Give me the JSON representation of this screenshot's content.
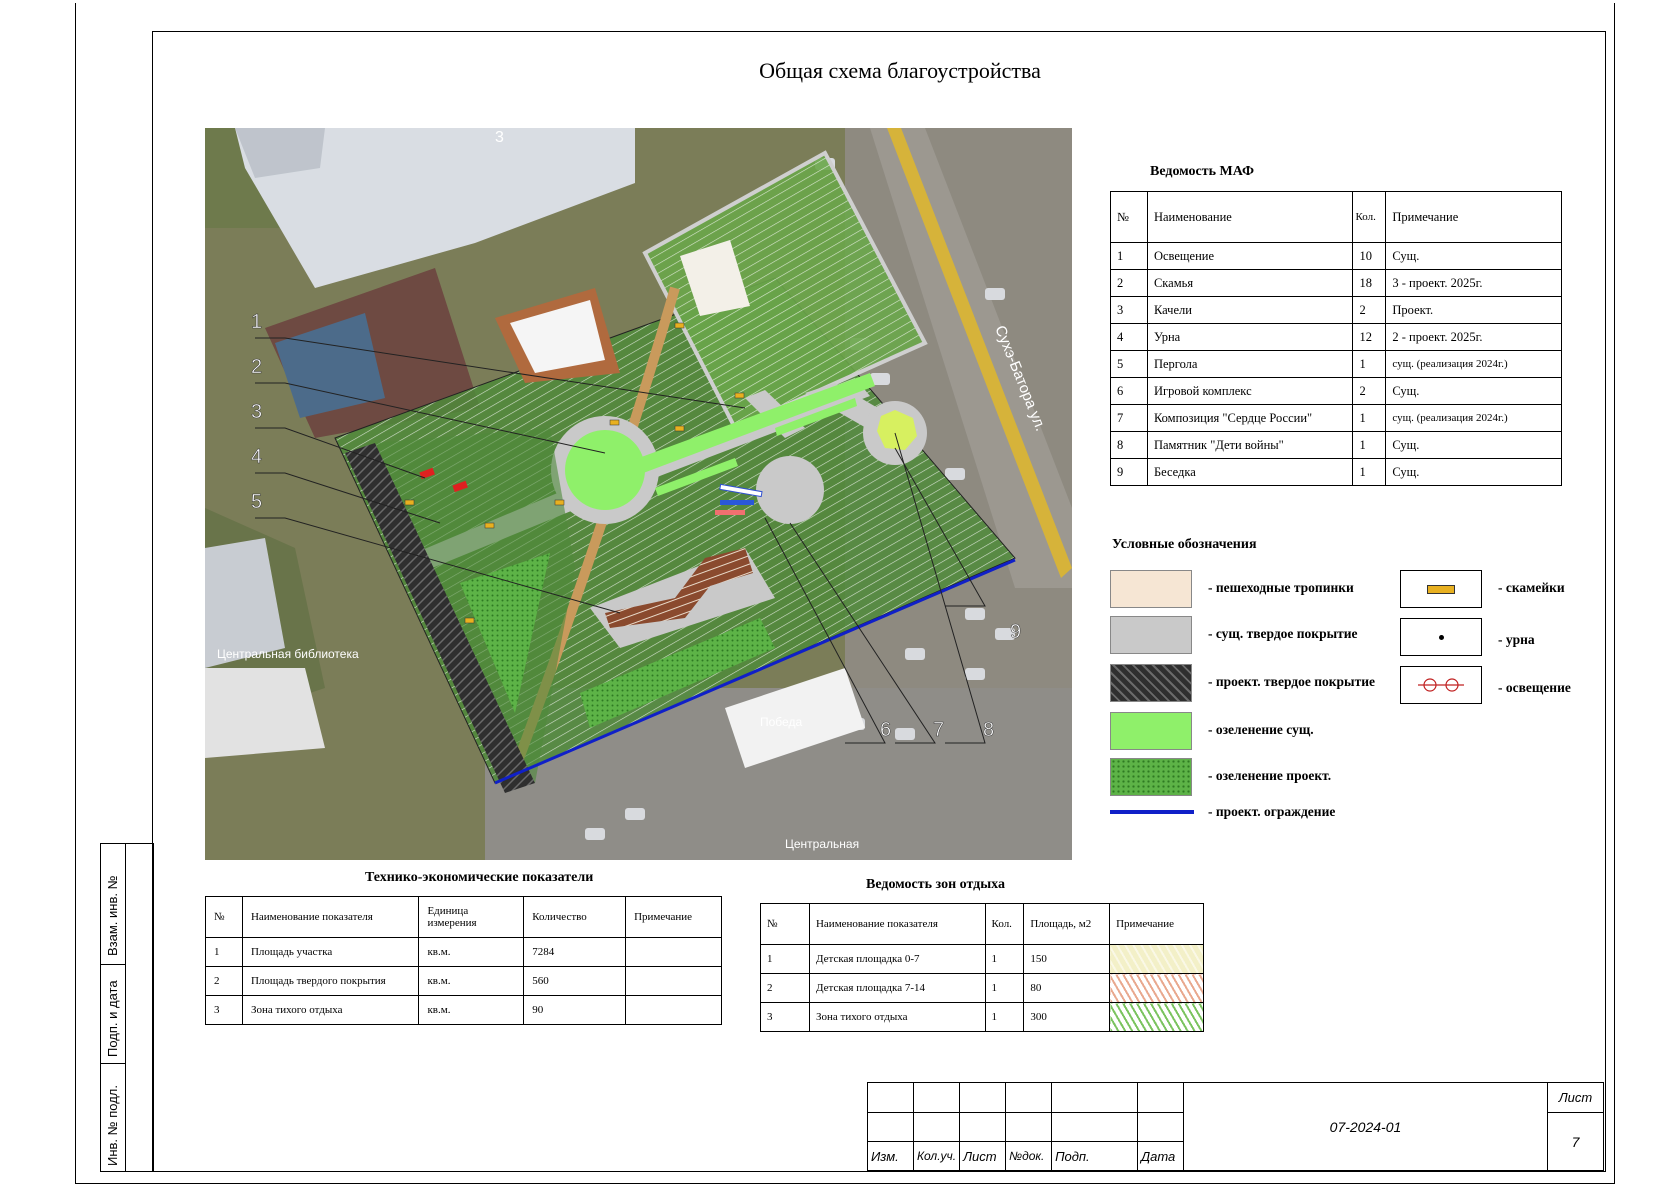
{
  "title": "Общая схема благоустройства",
  "map": {
    "street_label": "Сухэ-Батора ул.",
    "library_label": "Центральная библиотека",
    "pobeda_label": "Победа",
    "central_label": "Центральная",
    "building_number": "3",
    "callouts": [
      "1",
      "2",
      "3",
      "4",
      "5",
      "6",
      "7",
      "8",
      "9"
    ]
  },
  "maf": {
    "title": "Ведомость МАФ",
    "headers": [
      "№",
      "Наименование",
      "Кол.",
      "Примечание"
    ],
    "rows": [
      [
        "1",
        "Освещение",
        "10",
        "Сущ."
      ],
      [
        "2",
        "Скамья",
        "18",
        "3 - проект. 2025г."
      ],
      [
        "3",
        "Качели",
        "2",
        "Проект."
      ],
      [
        "4",
        "Урна",
        "12",
        "2 - проект. 2025г."
      ],
      [
        "5",
        "Пергола",
        "1",
        "сущ. (реализация 2024г.)"
      ],
      [
        "6",
        "Игровой комплекс",
        "2",
        "Сущ."
      ],
      [
        "7",
        "Композиция \"Сердце России\"",
        "1",
        "сущ. (реализация 2024г.)"
      ],
      [
        "8",
        "Памятник \"Дети войны\"",
        "1",
        "Сущ."
      ],
      [
        "9",
        "Беседка",
        "1",
        "Сущ."
      ]
    ]
  },
  "legend": {
    "title": "Условные обозначения",
    "items": [
      {
        "label": "- пешеходные тропинки",
        "color": "#f6e6d4"
      },
      {
        "label": "- сущ. твердое покрытие",
        "color": "#c9c9c9"
      },
      {
        "label": "- проект. твердое покрытие",
        "color": "#3a3a3a"
      },
      {
        "label": "- озеленение сущ.",
        "color": "#8ff06a"
      },
      {
        "label": "- озеленение проект.",
        "color": "#5db347"
      },
      {
        "label": "- проект. ограждение",
        "color": "#1020c8"
      }
    ],
    "symbols": [
      {
        "label": "- скамейки",
        "icon": "bench-icon"
      },
      {
        "label": "- урна",
        "icon": "urn-icon"
      },
      {
        "label": "- освещение",
        "icon": "light-icon"
      }
    ]
  },
  "tep": {
    "title": "Технико-экономические показатели",
    "headers": [
      "№",
      "Наименование показателя",
      "Единица измерения",
      "Количество",
      "Примечание"
    ],
    "rows": [
      [
        "1",
        "Площадь участка",
        "кв.м.",
        "7284",
        ""
      ],
      [
        "2",
        "Площадь твердого покрытия",
        "кв.м.",
        "560",
        ""
      ],
      [
        "3",
        "Зона тихого отдыха",
        "кв.м.",
        "90",
        ""
      ]
    ]
  },
  "zones": {
    "title": "Ведомость зон отдыха",
    "headers": [
      "№",
      "Наименование показателя",
      "Кол.",
      "Площадь, м2",
      "Примечание"
    ],
    "rows": [
      [
        "1",
        "Детская площадка 0-7",
        "1",
        "150",
        "#f3f0c8"
      ],
      [
        "2",
        "Детская площадка 7-14",
        "1",
        "80",
        "#e9a98f"
      ],
      [
        "3",
        "Зона тихого отдыха",
        "1",
        "300",
        "#bfe6a8"
      ]
    ]
  },
  "side_stamp": [
    "Взам. инв. №",
    "Подп. и дата",
    "Инв. № подл."
  ],
  "stamp": {
    "code": "07-2024-01",
    "sheet_label": "Лист",
    "sheet_number": "7",
    "columns": [
      "Изм.",
      "Кол.уч.",
      "Лист",
      "№док.",
      "Подп.",
      "Дата"
    ]
  }
}
